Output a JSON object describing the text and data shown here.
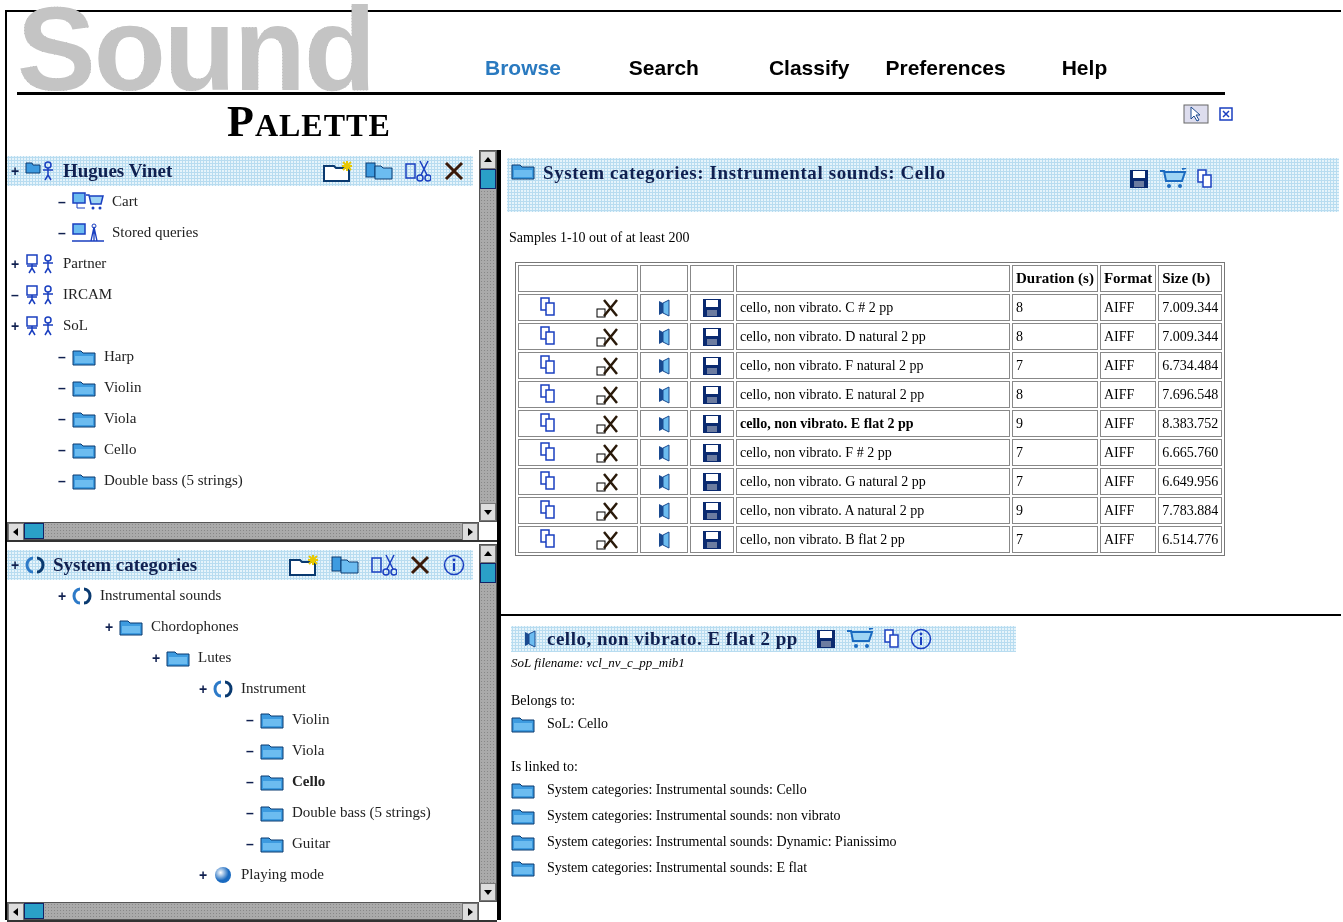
{
  "header": {
    "logo": "Sound",
    "subtitle": "PALETTE",
    "nav": [
      {
        "label": "Browse",
        "selected": true
      },
      {
        "label": "Search",
        "selected": false
      },
      {
        "label": "Classify",
        "selected": false
      },
      {
        "label": "Preferences",
        "selected": false
      },
      {
        "label": "Help",
        "selected": false
      }
    ]
  },
  "user_tree": {
    "header": {
      "label": "Hugues Vinet",
      "toggle": "+",
      "kind": "user",
      "children": [
        {
          "label": "Cart",
          "toggle": "–",
          "kind": "cart"
        },
        {
          "label": "Stored queries",
          "toggle": "–",
          "kind": "queries"
        }
      ]
    },
    "items": [
      {
        "label": "Partner",
        "toggle": "+",
        "kind": "group"
      },
      {
        "label": "IRCAM",
        "toggle": "–",
        "kind": "group"
      },
      {
        "label": "SoL",
        "toggle": "+",
        "kind": "group",
        "children": [
          {
            "label": "Harp",
            "toggle": "–",
            "kind": "folder"
          },
          {
            "label": "Violin",
            "toggle": "–",
            "kind": "folder"
          },
          {
            "label": "Viola",
            "toggle": "–",
            "kind": "folder"
          },
          {
            "label": "Cello",
            "toggle": "–",
            "kind": "folder"
          },
          {
            "label": "Double bass (5 strings)",
            "toggle": "–",
            "kind": "folder"
          }
        ]
      }
    ]
  },
  "category_tree": {
    "header": {
      "label": "System categories",
      "toggle": "+",
      "kind": "category",
      "children": [
        {
          "label": "Instrumental sounds",
          "toggle": "+",
          "kind": "category",
          "selected": false,
          "children": [
            {
              "label": "Chordophones",
              "toggle": "+",
              "kind": "folder",
              "selected": false,
              "children": [
                {
                  "label": "Lutes",
                  "toggle": "+",
                  "kind": "folder",
                  "selected": false,
                  "children": [
                    {
                      "label": "Instrument",
                      "toggle": "+",
                      "kind": "category",
                      "selected": false,
                      "children": [
                        {
                          "label": "Violin",
                          "toggle": "–",
                          "kind": "folder",
                          "selected": false
                        },
                        {
                          "label": "Viola",
                          "toggle": "–",
                          "kind": "folder",
                          "selected": false
                        },
                        {
                          "label": "Cello",
                          "toggle": "–",
                          "kind": "folder",
                          "selected": true
                        },
                        {
                          "label": "Double bass (5 strings)",
                          "toggle": "–",
                          "kind": "folder",
                          "selected": false
                        },
                        {
                          "label": "Guitar",
                          "toggle": "–",
                          "kind": "folder",
                          "selected": false
                        }
                      ]
                    },
                    {
                      "label": "Playing mode",
                      "toggle": "+",
                      "kind": "sphere",
                      "selected": false
                    }
                  ]
                }
              ]
            }
          ]
        }
      ]
    }
  },
  "results": {
    "title": "System categories: Instrumental sounds: Cello",
    "summary": "Samples 1-10 out of at least 200",
    "columns": [
      "Duration (s)",
      "Format",
      "Size (b)"
    ],
    "rows": [
      {
        "name": "cello, non vibrato. C # 2 pp",
        "duration": "8",
        "format": "AIFF",
        "size": "7.009.344",
        "selected": false
      },
      {
        "name": "cello, non vibrato. D natural 2 pp",
        "duration": "8",
        "format": "AIFF",
        "size": "7.009.344",
        "selected": false
      },
      {
        "name": "cello, non vibrato. F natural 2 pp",
        "duration": "7",
        "format": "AIFF",
        "size": "6.734.484",
        "selected": false
      },
      {
        "name": "cello, non vibrato. E natural 2 pp",
        "duration": "8",
        "format": "AIFF",
        "size": "7.696.548",
        "selected": false
      },
      {
        "name": "cello, non vibrato. E flat 2 pp",
        "duration": "9",
        "format": "AIFF",
        "size": "8.383.752",
        "selected": true
      },
      {
        "name": "cello, non vibrato. F # 2 pp",
        "duration": "7",
        "format": "AIFF",
        "size": "6.665.760",
        "selected": false
      },
      {
        "name": "cello, non vibrato. G natural 2 pp",
        "duration": "7",
        "format": "AIFF",
        "size": "6.649.956",
        "selected": false
      },
      {
        "name": "cello, non vibrato. A natural 2 pp",
        "duration": "9",
        "format": "AIFF",
        "size": "7.783.884",
        "selected": false
      },
      {
        "name": "cello, non vibrato. B flat 2 pp",
        "duration": "7",
        "format": "AIFF",
        "size": "6.514.776",
        "selected": false
      }
    ]
  },
  "detail": {
    "title": "cello, non vibrato. E flat 2 pp",
    "filename": "SoL filename: vcl_nv_c_pp_mib1",
    "belongs_label": "Belongs to:",
    "belongs": [
      "SoL: Cello"
    ],
    "links_label": "Is linked to:",
    "links": [
      "System categories: Instrumental sounds: Cello",
      "System categories: Instrumental sounds: non vibrato",
      "System categories: Instrumental sounds: Dynamic: Pianissimo",
      "System categories: Instrumental sounds: E flat"
    ]
  }
}
